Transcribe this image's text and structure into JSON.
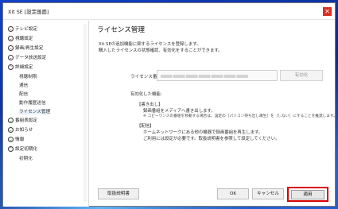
{
  "window": {
    "title": "Xit SE [設定画面]",
    "close_glyph": "✕"
  },
  "sidebar": {
    "items": [
      {
        "label": "テレビ設定",
        "icon": "chevron-down-icon",
        "glyph": "⌄"
      },
      {
        "label": "視聴設定",
        "icon": "chevron-down-icon",
        "glyph": "⌄"
      },
      {
        "label": "録画/再生設定",
        "icon": "chevron-down-icon",
        "glyph": "⌄"
      },
      {
        "label": "データ放送設定",
        "icon": "chevron-down-icon",
        "glyph": "⌄"
      },
      {
        "label": "詳細設定",
        "icon": "chevron-up-icon",
        "glyph": "⌃"
      },
      {
        "label": "視聴制限",
        "sub": true
      },
      {
        "label": "通信",
        "sub": true
      },
      {
        "label": "配信",
        "sub": true
      },
      {
        "label": "動作履歴送信",
        "sub": true
      },
      {
        "label": "ライセンス管理",
        "sub": true,
        "selected": true
      },
      {
        "label": "番組表設定",
        "icon": "chevron-down-icon",
        "glyph": "⌄"
      },
      {
        "label": "お知らせ",
        "icon": "chevron-down-icon",
        "glyph": "⌄"
      },
      {
        "label": "情報",
        "icon": "chevron-down-icon",
        "glyph": "⌄"
      },
      {
        "label": "設定初期化",
        "icon": "chevron-up-icon",
        "glyph": "⌃"
      },
      {
        "label": "初期化",
        "sub": true
      }
    ]
  },
  "main": {
    "title": "ライセンス管理",
    "desc_line1": "Xit SEの追加機能に関するライセンスを登録します。",
    "desc_line2": "購入したライセンスの状態確認、有効化をすることができます。",
    "license_label": "ライセンス番号:",
    "license_value": "",
    "activate_label": "有効化",
    "enabled_header": "有効化した機能:",
    "feature1_title": "【書き出し】",
    "feature1_line1": "録画番組をメディアへ書き出します。",
    "feature1_note": "※ コピーワンスの番組を移動する場合は、設定の［パソコン持ち出し再生］を［しない］にすることを推奨します。",
    "feature2_title": "【配信】",
    "feature2_line1": "ホームネットワークにある他の機器で録画番組を再生します。",
    "feature2_line2": "ご利用には設定が必要です。取扱説明書を参照して設定してください。"
  },
  "footer": {
    "manual_label": "取扱説明書",
    "ok_label": "OK",
    "cancel_label": "キャンセル",
    "apply_label": "適用"
  },
  "colors": {
    "highlight_border": "#d90000",
    "close_button": "#d93025"
  }
}
